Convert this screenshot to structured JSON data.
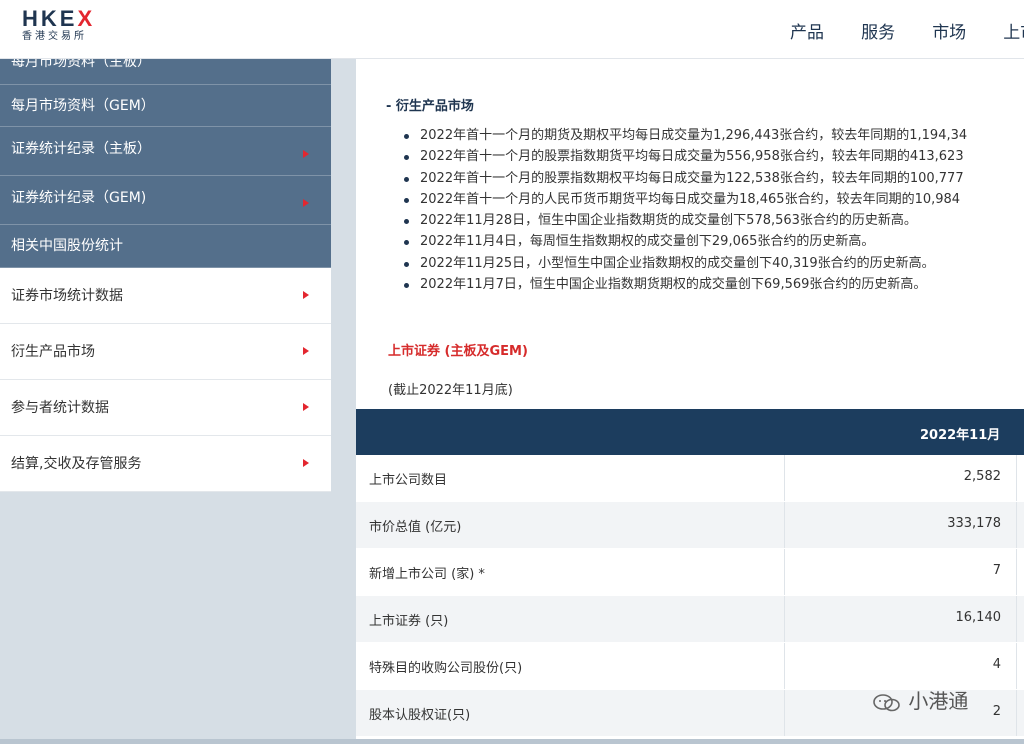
{
  "header": {
    "logo_text": "HKEX",
    "logo_sub": "香港交易所",
    "nav": [
      "产品",
      "服务",
      "市场",
      "上市"
    ]
  },
  "sidebar": {
    "dark_items": [
      {
        "label": "每月市场资料（主板）",
        "arrow": false
      },
      {
        "label": "每月市场资料（GEM）",
        "arrow": false
      },
      {
        "label": "证券统计纪录（主板）",
        "arrow": true
      },
      {
        "label": "证券统计纪录（GEM)",
        "arrow": true
      },
      {
        "label": "相关中国股份统计",
        "arrow": false
      }
    ],
    "light_items": [
      {
        "label": "证券市场统计数据"
      },
      {
        "label": "衍生产品市场"
      },
      {
        "label": "参与者统计数据"
      },
      {
        "label": "结算,交收及存管服务"
      }
    ]
  },
  "main": {
    "section_title": "- 衍生产品市场",
    "bullets": [
      "2022年首十一个月的期货及期权平均每日成交量为1,296,443张合约，较去年同期的1,194,34",
      "2022年首十一个月的股票指数期货平均每日成交量为556,958张合约，较去年同期的413,623",
      "2022年首十一个月的股票指数期权平均每日成交量为122,538张合约，较去年同期的100,777",
      "2022年首十一个月的人民币货币期货平均每日成交量为18,465张合约，较去年同期的10,984",
      "2022年11月28日，恒生中国企业指数期货的成交量创下578,563张合约的历史新高。",
      "2022年11月4日，每周恒生指数期权的成交量创下29,065张合约的历史新高。",
      "2022年11月25日，小型恒生中国企业指数期权的成交量创下40,319张合约的历史新高。",
      "2022年11月7日，恒生中国企业指数期货期权的成交量创下69,569张合约的历史新高。"
    ],
    "listed_title": "上市证券 (主板及GEM)",
    "as_of": "(截止2022年11月底)",
    "table": {
      "header": "2022年11月",
      "rows": [
        {
          "label": "上市公司数目",
          "value": "2,582"
        },
        {
          "label": "市价总值 (亿元)",
          "value": "333,178"
        },
        {
          "label": "新增上市公司 (家) *",
          "value": "7"
        },
        {
          "label": "上市证券 (只)",
          "value": "16,140"
        },
        {
          "label": "特殊目的收购公司股份(只)",
          "value": "4"
        },
        {
          "label": "股本认股权证(只)",
          "value": "2"
        }
      ]
    }
  },
  "watermark": "小港通",
  "colors": {
    "accent_red": "#e3262f",
    "sidebar_dark": "#546f8b",
    "table_header": "#1c3d5e",
    "brand_navy": "#1f3550"
  }
}
